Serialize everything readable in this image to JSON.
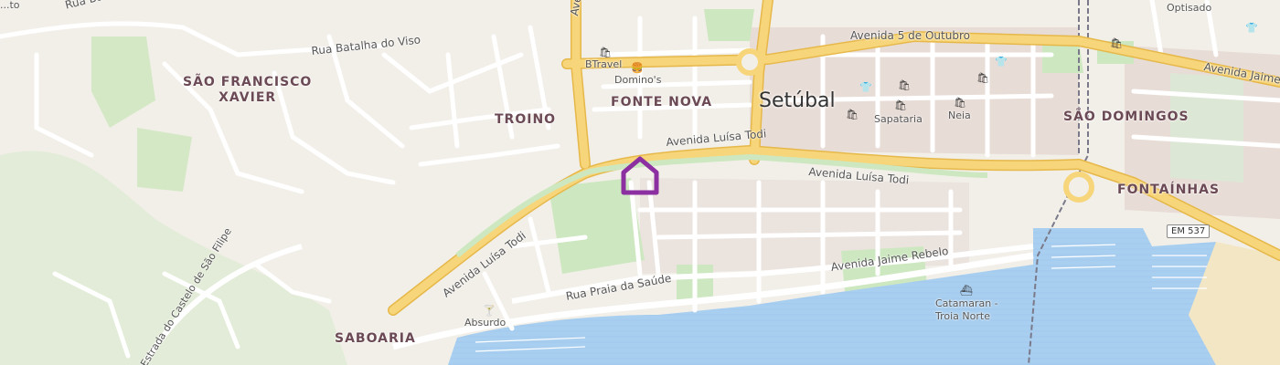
{
  "map": {
    "city": "Setúbal",
    "districts": [
      {
        "id": "sao-francisco-xavier",
        "line1": "SÃO FRANCISCO",
        "line2": "XAVIER"
      },
      {
        "id": "troino",
        "line1": "TROINO"
      },
      {
        "id": "fonte-nova",
        "line1": "FONTE NOVA"
      },
      {
        "id": "sao-domingos",
        "line1": "SÃO DOMINGOS"
      },
      {
        "id": "fontainhas",
        "line1": "FONTAÍNHAS"
      },
      {
        "id": "saboaria",
        "line1": "SABOARIA"
      }
    ],
    "streets": {
      "batalha_viso_top": "Rua Batalha do Viso",
      "batalha_viso": "Rua Batalha do Viso",
      "avenida_top": "Avenida",
      "cinco_outubro": "Avenida 5 de Outubro",
      "jaime_top": "Avenida Jaime",
      "luisa_todi_1": "Avenida Luísa Todi",
      "luisa_todi_2": "Avenida Luísa Todi",
      "luisa_todi_3": "Avenida Luísa Todi",
      "praia_saude": "Rua Praia da Saúde",
      "jaime_rebelo": "Avenida Jaime Rebelo",
      "castelo": "Estrada do Castelo de São Filipe",
      "top_left_fragment": "...to"
    },
    "pois": {
      "btravel": "BTravel",
      "dominos": "Domino's",
      "sapataria": "Sapataria",
      "neia": "Neia",
      "absurdo": "Absurdo",
      "catamaran_1": "Catamaran -",
      "catamaran_2": "Troia Norte",
      "optisado": "Optisado"
    },
    "road_shield": "EM 537",
    "icons": {
      "shop": "shopping-bag-icon",
      "fast_food": "fast-food-icon",
      "clothes": "clothes-icon",
      "bar": "cocktail-bar-icon",
      "ferry": "ferry-icon",
      "marker": "home-marker-icon"
    },
    "colors": {
      "land": "#f2efe9",
      "urban": "#e8dcd6",
      "park": "#cde8c0",
      "water": "#a9cff0",
      "major_road": "#f7d57a",
      "marker": "#8b2fa1"
    }
  }
}
